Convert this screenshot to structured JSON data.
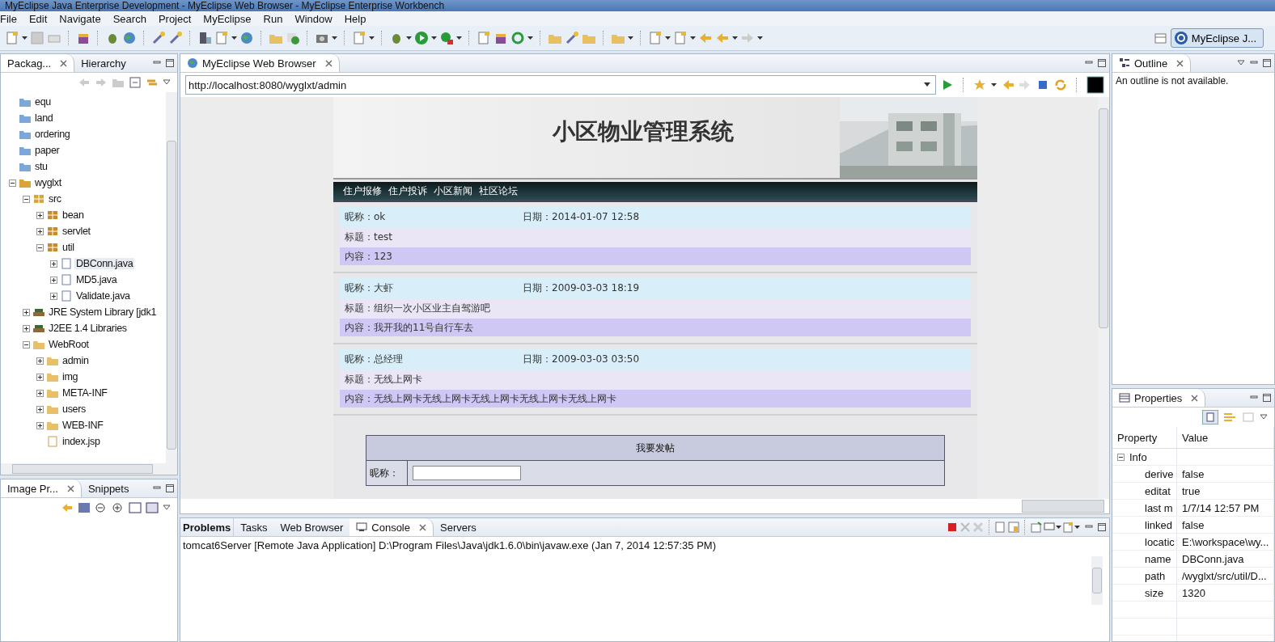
{
  "window": {
    "title": "MyEclipse Java Enterprise Development - MyEclipse Web Browser - MyEclipse Enterprise Workbench"
  },
  "menu": [
    "File",
    "Edit",
    "Navigate",
    "Search",
    "Project",
    "MyEclipse",
    "Run",
    "Window",
    "Help"
  ],
  "perspective": {
    "label": "MyEclipse J..."
  },
  "package_explorer": {
    "tabs": [
      {
        "label": "Packag...",
        "selected": true
      },
      {
        "label": "Hierarchy",
        "selected": false
      }
    ],
    "tree": [
      {
        "label": "equ",
        "kind": "folder"
      },
      {
        "label": "land",
        "kind": "folder"
      },
      {
        "label": "ordering",
        "kind": "folder"
      },
      {
        "label": "paper",
        "kind": "folder"
      },
      {
        "label": "stu",
        "kind": "folder"
      },
      {
        "label": "wyglxt",
        "kind": "project",
        "expanded": true,
        "children": [
          {
            "label": "src",
            "kind": "source",
            "expanded": true,
            "children": [
              {
                "label": "bean",
                "kind": "package",
                "expanded": false
              },
              {
                "label": "servlet",
                "kind": "package",
                "expanded": false
              },
              {
                "label": "util",
                "kind": "package",
                "expanded": true,
                "children": [
                  {
                    "label": "DBConn.java",
                    "kind": "java",
                    "expanded": false,
                    "selected": true
                  },
                  {
                    "label": "MD5.java",
                    "kind": "java",
                    "expanded": false,
                    "selected": false
                  },
                  {
                    "label": "Validate.java",
                    "kind": "java",
                    "expanded": false,
                    "selected": false
                  }
                ]
              }
            ]
          },
          {
            "label": "JRE System Library [jdk1",
            "kind": "library",
            "expanded": false
          },
          {
            "label": "J2EE 1.4 Libraries",
            "kind": "library",
            "expanded": false
          },
          {
            "label": "WebRoot",
            "kind": "webfolder",
            "expanded": true,
            "children": [
              {
                "label": "admin",
                "kind": "webfolder",
                "expanded": false
              },
              {
                "label": "img",
                "kind": "webfolder",
                "expanded": false
              },
              {
                "label": "META-INF",
                "kind": "webfolder",
                "expanded": false
              },
              {
                "label": "users",
                "kind": "webfolder",
                "expanded": false
              },
              {
                "label": "WEB-INF",
                "kind": "webfolder",
                "expanded": false
              },
              {
                "label": "index.jsp",
                "kind": "jsp"
              }
            ]
          }
        ]
      }
    ]
  },
  "image_preview": {
    "tabs": [
      {
        "label": "Image Pr...",
        "selected": true
      },
      {
        "label": "Snippets",
        "selected": false
      }
    ]
  },
  "browser": {
    "tab": "MyEclipse Web Browser",
    "url": "http://localhost:8080/wyglxt/admin",
    "page": {
      "title": "小区物业管理系统",
      "nav": [
        "住户报修",
        "住户投诉",
        "小区新闻",
        "社区论坛"
      ],
      "posts": [
        {
          "nickname": "昵称：ok",
          "date": "日期：2014-01-07 12:58",
          "title": "标题：test",
          "content": "内容：123"
        },
        {
          "nickname": "昵称：大虾",
          "date": "日期：2009-03-03 18:19",
          "title": "标题：组织一次小区业主自驾游吧",
          "content": "内容：我开我的11号自行车去"
        },
        {
          "nickname": "昵称：总经理",
          "date": "日期：2009-03-03 03:50",
          "title": "标题：无线上网卡",
          "content": "内容：无线上网卡无线上网卡无线上网卡无线上网卡无线上网卡"
        }
      ],
      "form": {
        "header": "我要发帖",
        "label": "昵称："
      }
    }
  },
  "outline": {
    "tab": "Outline",
    "message": "An outline is not available."
  },
  "properties": {
    "tab": "Properties",
    "columns": [
      "Property",
      "Value"
    ],
    "group": {
      "label": "Info",
      "expanded": true
    },
    "rows": [
      {
        "name": "derive",
        "value": "false"
      },
      {
        "name": "editat",
        "value": "true"
      },
      {
        "name": "last m",
        "value": "1/7/14 12:57 PM"
      },
      {
        "name": "linked",
        "value": "false"
      },
      {
        "name": "locatic",
        "value": "E:\\workspace\\wy..."
      },
      {
        "name": "name",
        "value": "DBConn.java"
      },
      {
        "name": "path",
        "value": "/wyglxt/src/util/D..."
      },
      {
        "name": "size",
        "value": "1320"
      }
    ]
  },
  "console": {
    "tabs": [
      {
        "label": "Problems",
        "selected": false,
        "changed": true
      },
      {
        "label": "Tasks",
        "selected": false,
        "changed": false
      },
      {
        "label": "Web Browser",
        "selected": false,
        "changed": false
      },
      {
        "label": "Console",
        "selected": true,
        "changed": false
      },
      {
        "label": "Servers",
        "selected": false,
        "changed": false
      }
    ],
    "line": "tomcat6Server [Remote Java Application] D:\\Program Files\\Java\\jdk1.6.0\\bin\\javaw.exe (Jan 7, 2014 12:57:35 PM)"
  }
}
